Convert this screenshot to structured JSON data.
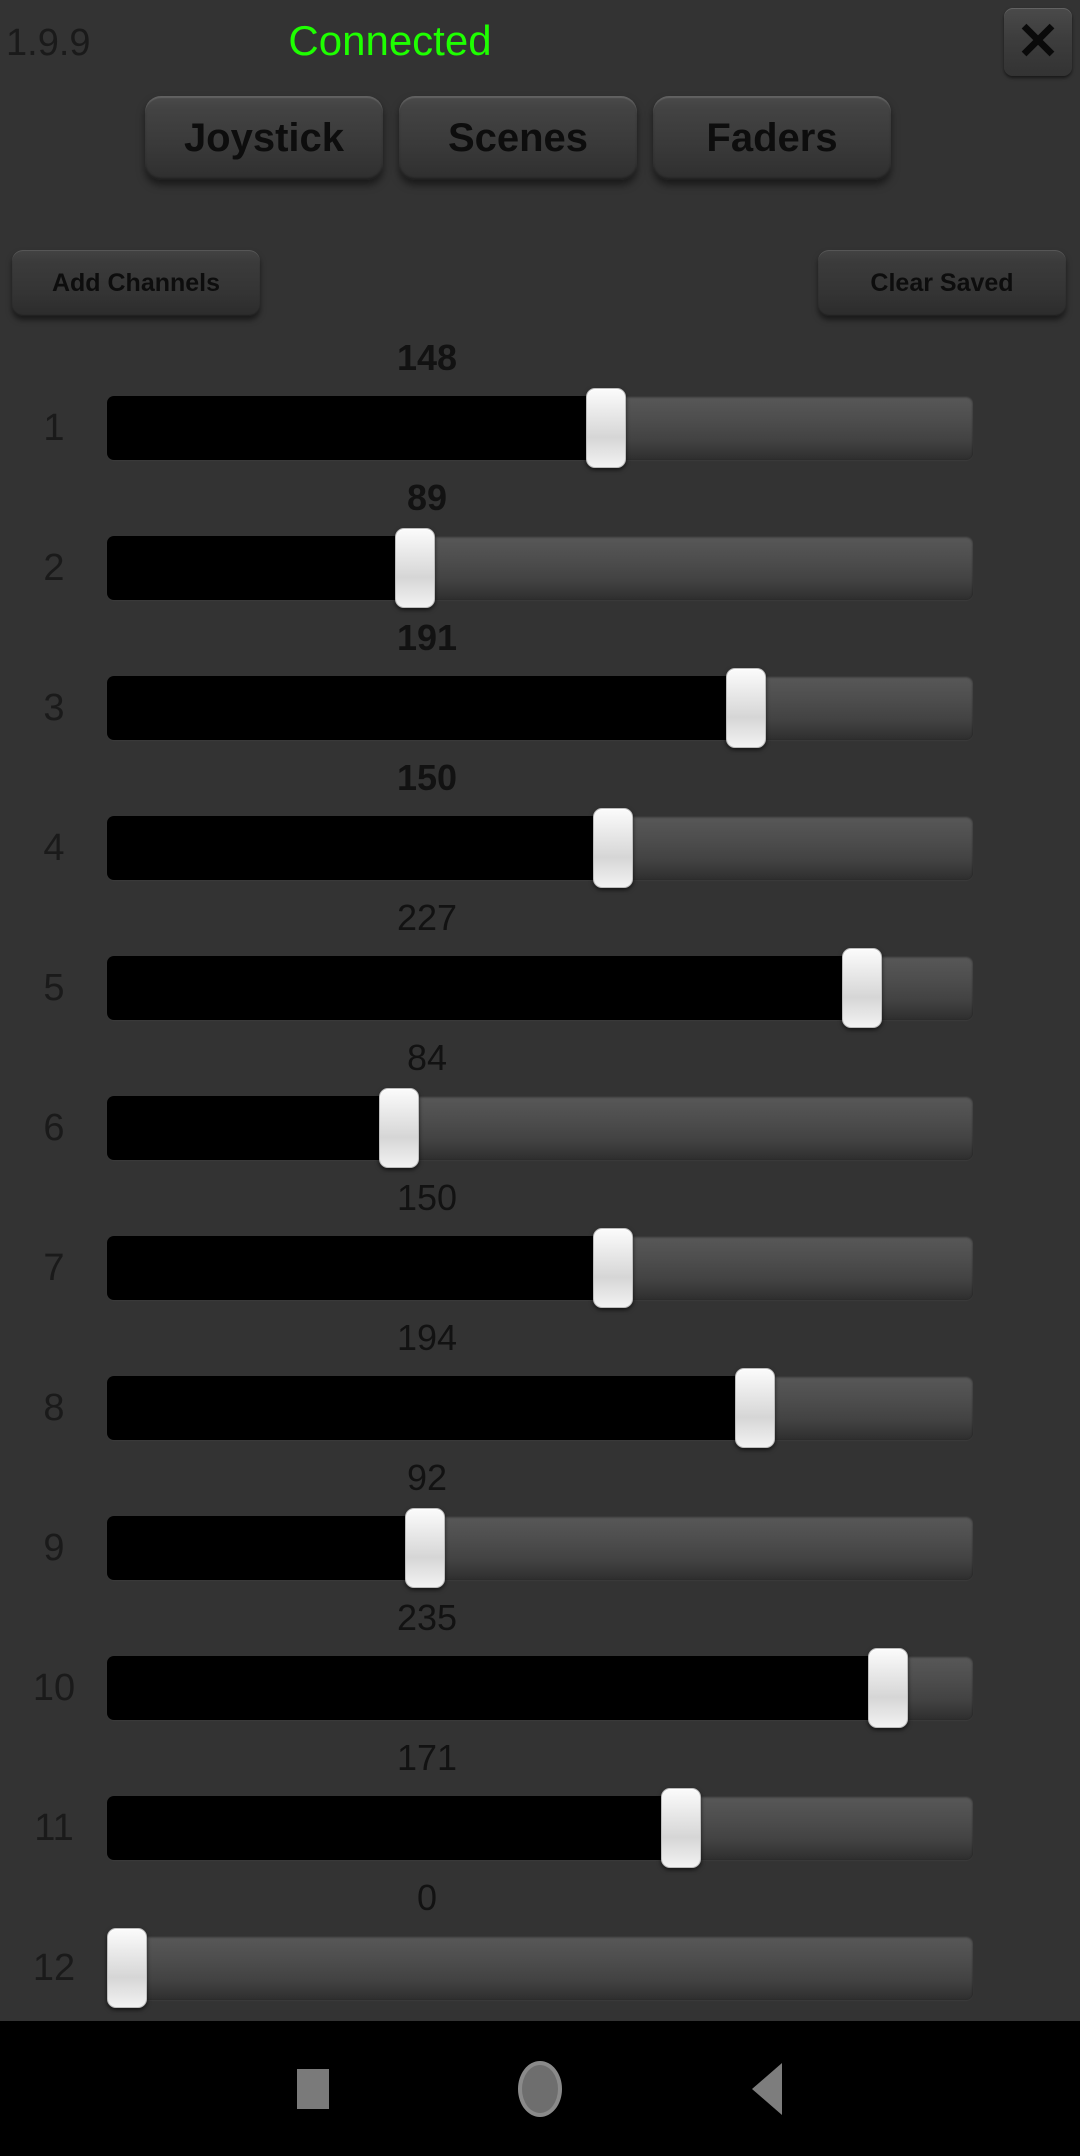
{
  "header": {
    "version": "1.9.9",
    "status_text": "Connected",
    "status_color": "#1eff00",
    "close_label": "✕"
  },
  "tabs": [
    {
      "label": "Joystick"
    },
    {
      "label": "Scenes"
    },
    {
      "label": "Faders"
    }
  ],
  "actions": {
    "add_channels_label": "Add Channels",
    "clear_saved_label": "Clear Saved"
  },
  "faders": {
    "min": 0,
    "max": 255,
    "rows": [
      {
        "index": "1",
        "value": "148",
        "bold": true
      },
      {
        "index": "2",
        "value": "89",
        "bold": true
      },
      {
        "index": "3",
        "value": "191",
        "bold": true
      },
      {
        "index": "4",
        "value": "150",
        "bold": true
      },
      {
        "index": "5",
        "value": "227",
        "bold": false
      },
      {
        "index": "6",
        "value": "84",
        "bold": false
      },
      {
        "index": "7",
        "value": "150",
        "bold": false
      },
      {
        "index": "8",
        "value": "194",
        "bold": false
      },
      {
        "index": "9",
        "value": "92",
        "bold": false
      },
      {
        "index": "10",
        "value": "235",
        "bold": false
      },
      {
        "index": "11",
        "value": "171",
        "bold": false
      },
      {
        "index": "12",
        "value": "0",
        "bold": false
      }
    ]
  },
  "navbar": {
    "recents_label": "recents",
    "home_label": "home",
    "back_label": "back"
  }
}
